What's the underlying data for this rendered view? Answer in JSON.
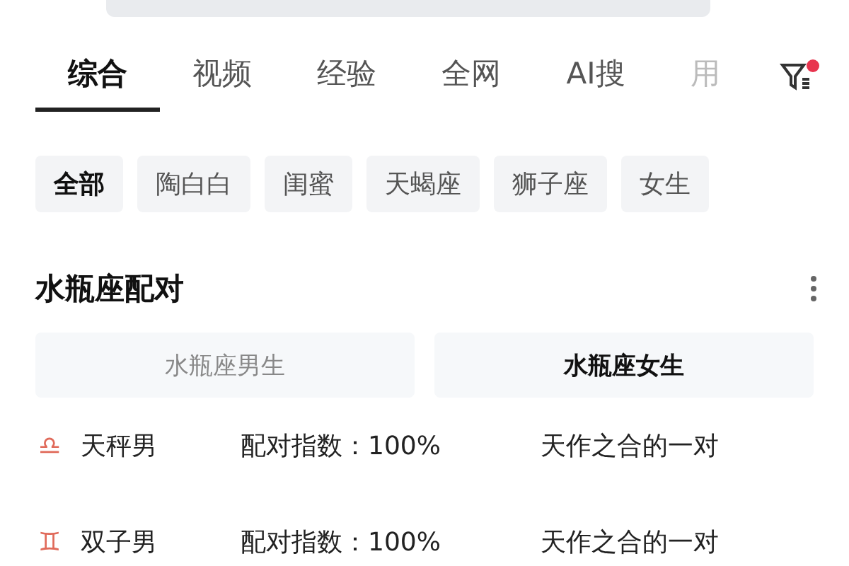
{
  "tabs": [
    {
      "label": "综合",
      "selected": true
    },
    {
      "label": "视频",
      "selected": false
    },
    {
      "label": "经验",
      "selected": false
    },
    {
      "label": "全网",
      "selected": false
    },
    {
      "label": "AI搜",
      "selected": false
    },
    {
      "label": "用",
      "selected": false
    }
  ],
  "filter": {
    "badge": true
  },
  "chips": [
    {
      "label": "全部",
      "selected": true
    },
    {
      "label": "陶白白",
      "selected": false
    },
    {
      "label": "闺蜜",
      "selected": false
    },
    {
      "label": "天蝎座",
      "selected": false
    },
    {
      "label": "狮子座",
      "selected": false
    },
    {
      "label": "女生",
      "selected": false
    }
  ],
  "card": {
    "title": "水瓶座配对",
    "segments": [
      {
        "label": "水瓶座男生",
        "selected": false
      },
      {
        "label": "水瓶座女生",
        "selected": true
      }
    ],
    "rows": [
      {
        "symbol": "♎",
        "sign": "天秤男",
        "score": "配对指数：100%",
        "verdict": "天作之合的一对"
      },
      {
        "symbol": "♊",
        "sign": "双子男",
        "score": "配对指数：100%",
        "verdict": "天作之合的一对"
      }
    ]
  }
}
